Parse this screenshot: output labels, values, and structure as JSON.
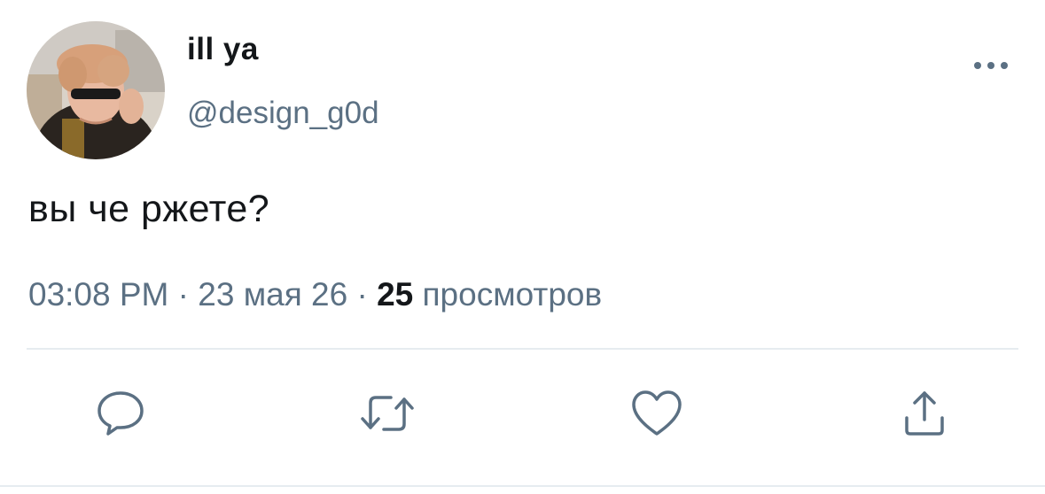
{
  "author": {
    "display_name": "ill ya",
    "handle": "@design_g0d",
    "avatar": "user-avatar-photo"
  },
  "tweet": {
    "text": "вы че ржете?"
  },
  "meta": {
    "time": "03:08 PM",
    "sep1": " · ",
    "date": "23 мая 26",
    "sep2": " · ",
    "views_count": "25",
    "views_label": " просмотров"
  },
  "icons": {
    "more": "more-horizontal-icon",
    "reply": "reply-bubble-icon",
    "retweet": "retweet-icon",
    "like": "heart-icon",
    "share": "share-upload-icon"
  },
  "colors": {
    "text_primary": "#14171a",
    "text_secondary": "#5b7083",
    "divider": "#e6ecf0"
  }
}
